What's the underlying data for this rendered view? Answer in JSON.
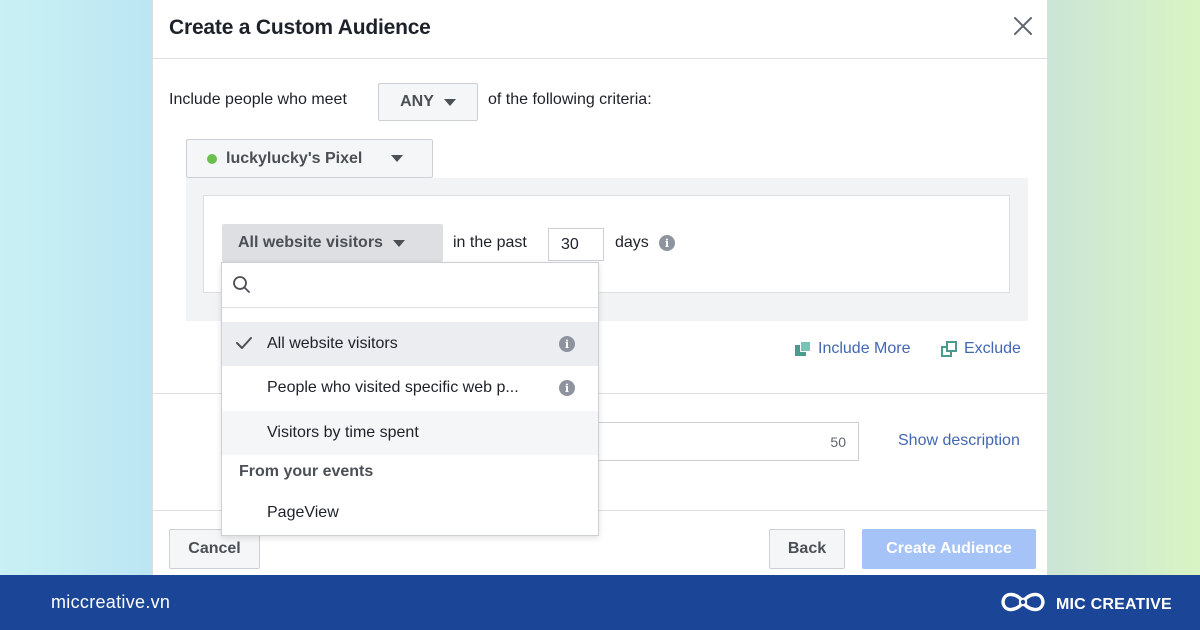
{
  "dialog": {
    "title": "Create a Custom Audience",
    "criteria_prefix": "Include people who meet",
    "match_mode": "ANY",
    "criteria_suffix": "of the following criteria:",
    "pixel_name": "luckylucky's Pixel",
    "rule": {
      "source": "All website visitors",
      "in_the_past": "in the past",
      "days_value": "30",
      "days_label": "days"
    },
    "include_more": "Include More",
    "exclude": "Exclude",
    "char_remaining": "50",
    "show_description": "Show description",
    "buttons": {
      "cancel": "Cancel",
      "back": "Back",
      "create": "Create Audience"
    }
  },
  "dropdown": {
    "search_placeholder": "",
    "items": [
      {
        "label": "All website visitors",
        "selected": true
      },
      {
        "label": "People who visited specific web p..."
      },
      {
        "label": "Visitors by time spent"
      }
    ],
    "group_label": "From your events",
    "event_items": [
      {
        "label": "PageView"
      }
    ]
  },
  "banner": {
    "url": "miccreative.vn",
    "brand": "MIC CREATIVE"
  },
  "colors": {
    "link": "#4267b2",
    "banner": "#1b4596",
    "pixel_status": "#6bc150",
    "create_disabled": "#a5c3f7"
  }
}
